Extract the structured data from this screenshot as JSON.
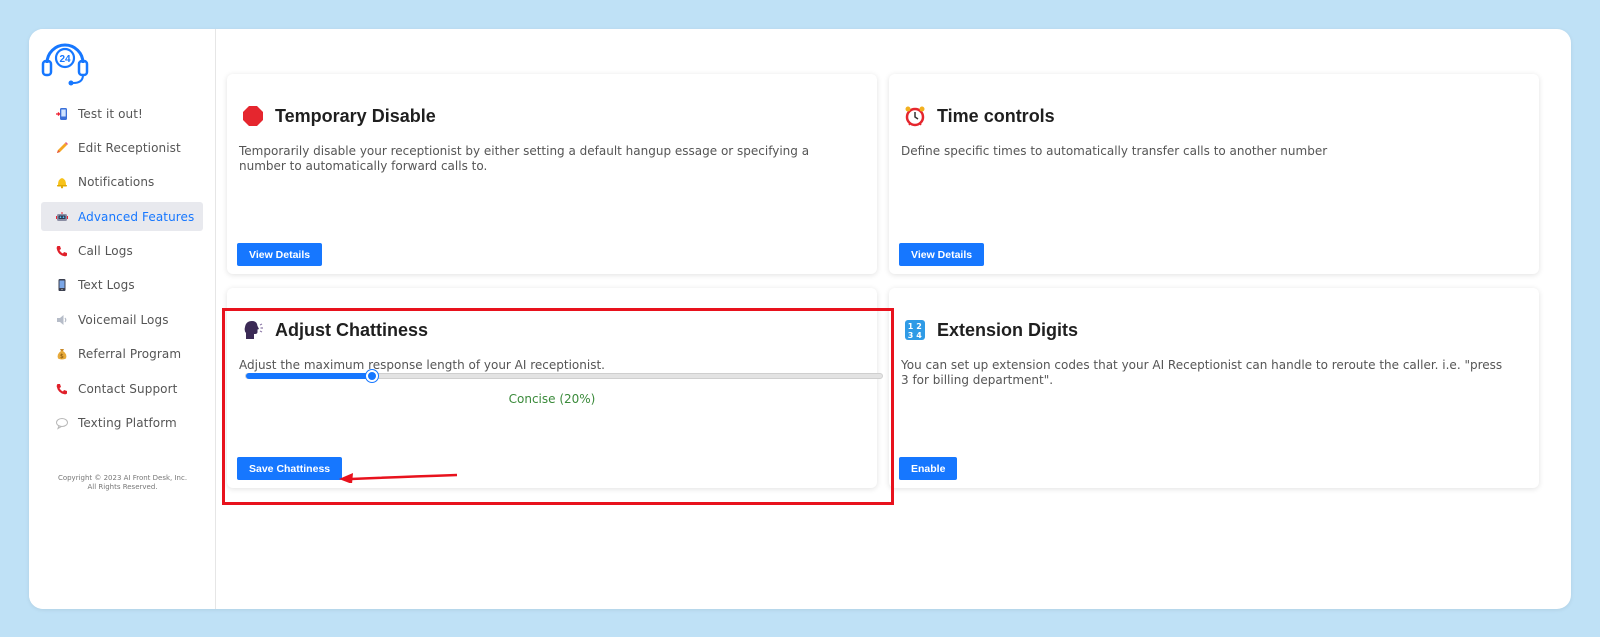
{
  "sidebar": {
    "items": [
      {
        "label": "Test it out!",
        "icon": "phone-device-icon"
      },
      {
        "label": "Edit Receptionist",
        "icon": "pencil-icon"
      },
      {
        "label": "Notifications",
        "icon": "bell-icon"
      },
      {
        "label": "Advanced Features",
        "icon": "robot-icon",
        "active": true
      },
      {
        "label": "Call Logs",
        "icon": "phone-icon"
      },
      {
        "label": "Text Logs",
        "icon": "mobile-icon"
      },
      {
        "label": "Voicemail Logs",
        "icon": "speaker-icon"
      },
      {
        "label": "Referral Program",
        "icon": "money-bag-icon"
      },
      {
        "label": "Contact Support",
        "icon": "phone-icon"
      },
      {
        "label": "Texting Platform",
        "icon": "speech-bubble-icon"
      }
    ],
    "copyright_line1": "Copyright © 2023 AI Front Desk, Inc.",
    "copyright_line2": "All Rights Reserved.",
    "logo": "headset-24-logo"
  },
  "cards": {
    "temporary_disable": {
      "title": "Temporary Disable",
      "icon": "stop-sign-icon",
      "description": "Temporarily disable your receptionist by either setting a default hangup essage or specifying a number to automatically forward calls to.",
      "button": "View Details"
    },
    "time_controls": {
      "title": "Time controls",
      "icon": "alarm-clock-icon",
      "description": "Define specific times to automatically transfer calls to another number",
      "button": "View Details"
    },
    "adjust_chattiness": {
      "title": "Adjust Chattiness",
      "icon": "speaking-head-icon",
      "description": "Adjust the maximum response length of your AI receptionist.",
      "slider_value_percent": 20,
      "slider_label": "Concise (20%)",
      "button": "Save Chattiness"
    },
    "extension_digits": {
      "title": "Extension Digits",
      "icon": "input-numbers-icon",
      "description": "You can set up extension codes that your AI Receptionist can handle to reroute the caller. i.e. \"press 3 for billing department\".",
      "button": "Enable"
    }
  },
  "colors": {
    "background": "#bfe1f6",
    "accent": "#1677ff",
    "highlight": "#e8121d",
    "slider_label": "#3a8a3a"
  }
}
